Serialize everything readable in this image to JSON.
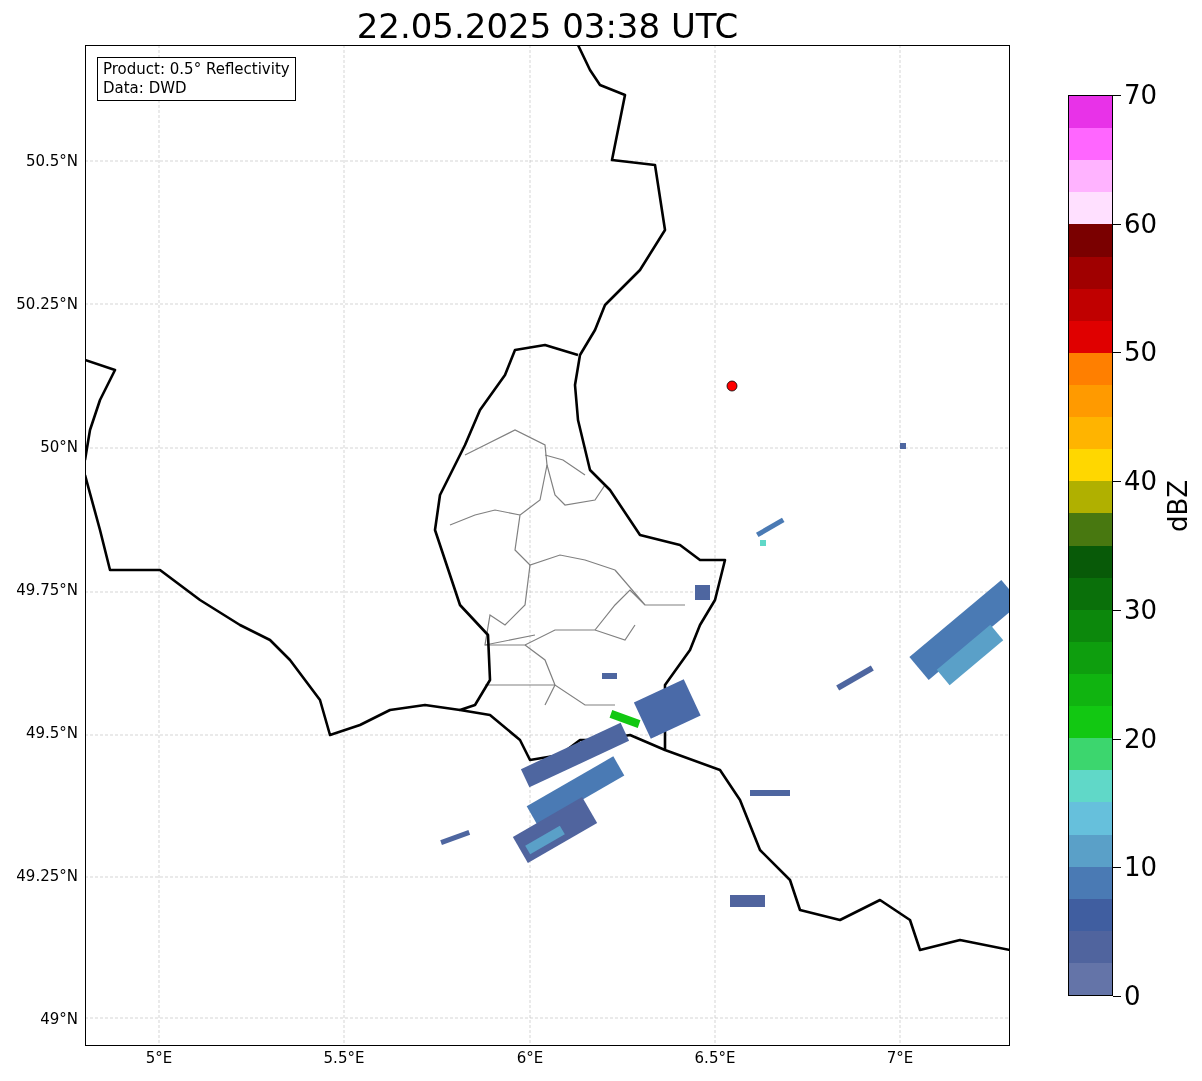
{
  "title": "22.05.2025 03:38 UTC",
  "info_box": [
    "Product: 0.5° Reflectivity",
    "Data: DWD"
  ],
  "x_ticks": [
    "5°E",
    "5.5°E",
    "6°E",
    "6.5°E",
    "7°E"
  ],
  "y_ticks": [
    "50.5°N",
    "50.25°N",
    "50°N",
    "49.75°N",
    "49.5°N",
    "49.25°N",
    "49°N"
  ],
  "colorbar": {
    "label": "dBZ",
    "ticks": [
      "70",
      "60",
      "50",
      "40",
      "30",
      "20",
      "10",
      "0"
    ],
    "bands": [
      {
        "color": "#e832e8"
      },
      {
        "color": "#ff66ff"
      },
      {
        "color": "#ffb3ff"
      },
      {
        "color": "#ffe0ff"
      },
      {
        "color": "#7a0000"
      },
      {
        "color": "#a00000"
      },
      {
        "color": "#c00000"
      },
      {
        "color": "#e00000"
      },
      {
        "color": "#ff7f00"
      },
      {
        "color": "#ff9a00"
      },
      {
        "color": "#ffb400"
      },
      {
        "color": "#ffd700"
      },
      {
        "color": "#b0b000"
      },
      {
        "color": "#487810"
      },
      {
        "color": "#085a08"
      },
      {
        "color": "#0a700a"
      },
      {
        "color": "#0c880c"
      },
      {
        "color": "#0e9e0e"
      },
      {
        "color": "#10b410"
      },
      {
        "color": "#12c812"
      },
      {
        "color": "#3cd66e"
      },
      {
        "color": "#60d8c8"
      },
      {
        "color": "#66c0dc"
      },
      {
        "color": "#5aa0c8"
      },
      {
        "color": "#4a7ab4"
      },
      {
        "color": "#405ea0"
      },
      {
        "color": "#50649e"
      },
      {
        "color": "#6474a8"
      }
    ]
  }
}
